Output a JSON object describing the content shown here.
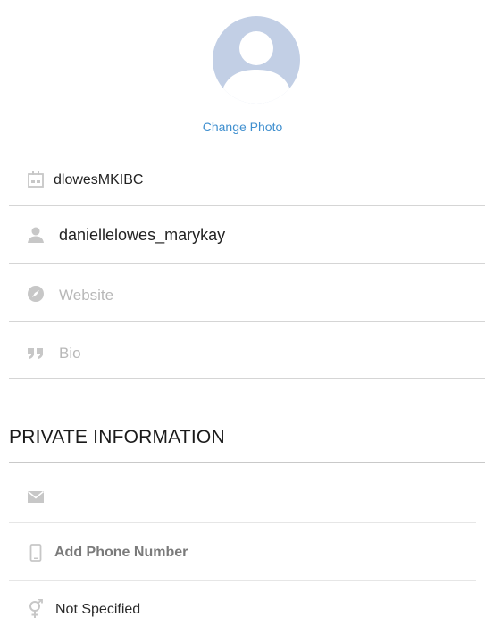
{
  "profile": {
    "change_photo_label": "Change Photo"
  },
  "public_fields": {
    "name_value": "dlowesMKIBC",
    "username_value": "daniellelowes_marykay",
    "website_placeholder": "Website",
    "bio_placeholder": "Bio"
  },
  "private_info": {
    "section_title": "PRIVATE INFORMATION",
    "email_value": "",
    "phone_label": "Add Phone Number",
    "gender_value": "Not Specified"
  },
  "colors": {
    "accent": "#3f8fcf",
    "icon_gray": "#c7c7c7",
    "avatar_bg": "#c2cfe5",
    "divider": "#d5d5d5"
  }
}
